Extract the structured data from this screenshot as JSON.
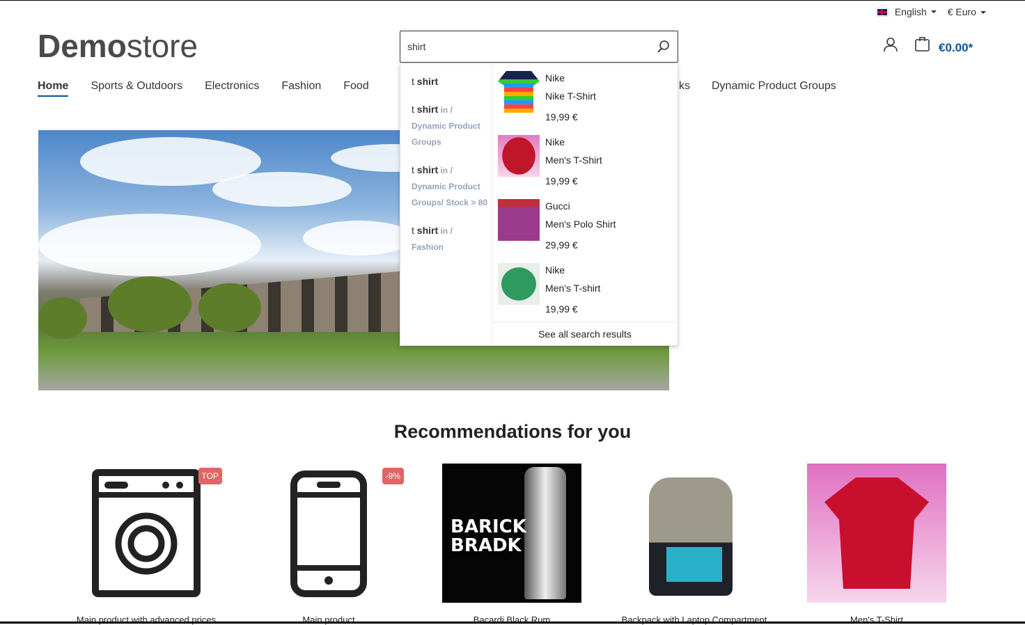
{
  "topbar": {
    "language": "English",
    "currency": "€ Euro"
  },
  "logo": {
    "bold": "Demo",
    "light": "store"
  },
  "search": {
    "value": "shirt"
  },
  "header": {
    "cart_total": "€0.00*"
  },
  "nav": {
    "items": [
      "Home",
      "Sports & Outdoors",
      "Electronics",
      "Fashion",
      "Food"
    ],
    "partial": "ks",
    "last": "Dynamic Product Groups"
  },
  "dropdown": {
    "suggestions": [
      {
        "prefix": "t ",
        "term": "shirt",
        "in": "",
        "path": ""
      },
      {
        "prefix": "t ",
        "term": "shirt",
        "in": " in /",
        "path": "Dynamic Product Groups"
      },
      {
        "prefix": "t ",
        "term": "shirt",
        "in": " in /",
        "path": "Dynamic Product Groups/ Stock > 80"
      },
      {
        "prefix": "t ",
        "term": "shirt",
        "in": " in /",
        "path": "Fashion"
      }
    ],
    "products": [
      {
        "brand": "Nike",
        "name": "Nike T-Shirt",
        "price": "19,99 €"
      },
      {
        "brand": "Nike",
        "name": "Men's T-Shirt",
        "price": "19,99 €"
      },
      {
        "brand": "Gucci",
        "name": "Men's Polo Shirt",
        "price": "29,99 €"
      },
      {
        "brand": "Nike",
        "name": "Men's T-shirt",
        "price": "19,99 €"
      }
    ],
    "see_all": "See all search results"
  },
  "recommendations": {
    "title": "Recommendations for you",
    "items": [
      {
        "name": "Main product with advanced prices",
        "badge": "TOP"
      },
      {
        "name": "Main product",
        "badge": "-9%"
      },
      {
        "name": "Bacardi Black Rum",
        "badge": ""
      },
      {
        "name": "Backpack with Laptop Compartment",
        "badge": ""
      },
      {
        "name": "Men's T-Shirt",
        "badge": ""
      }
    ]
  },
  "colors": {
    "accent": "#0b539b",
    "badge": "#e06666",
    "path": "#94a3b8"
  }
}
